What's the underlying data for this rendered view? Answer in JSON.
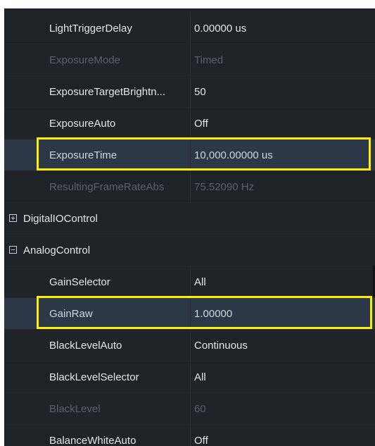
{
  "properties": [
    {
      "name": "LightTriggerDelay",
      "value": "0.00000 us",
      "state": "normal"
    },
    {
      "name": "ExposureMode",
      "value": "Timed",
      "state": "disabled"
    },
    {
      "name": "ExposureTargetBrightn...",
      "value": "50",
      "state": "normal"
    },
    {
      "name": "ExposureAuto",
      "value": "Off",
      "state": "normal"
    },
    {
      "name": "ExposureTime",
      "value": "10,000.00000 us",
      "state": "highlighted"
    },
    {
      "name": "ResultingFrameRateAbs",
      "value": "75.52090 Hz",
      "state": "disabled"
    },
    {
      "name": "DigitalIOControl",
      "category": true,
      "expander": "+",
      "expanded": false
    },
    {
      "name": "AnalogControl",
      "category": true,
      "expander": "−",
      "expanded": true
    },
    {
      "name": "GainSelector",
      "value": "All",
      "state": "normal"
    },
    {
      "name": "GainRaw",
      "value": "1.00000",
      "state": "highlighted"
    },
    {
      "name": "BlackLevelAuto",
      "value": "Continuous",
      "state": "normal"
    },
    {
      "name": "BlackLevelSelector",
      "value": "All",
      "state": "normal"
    },
    {
      "name": "BlackLevel",
      "value": "60",
      "state": "disabled"
    },
    {
      "name": "BalanceWhiteAuto",
      "value": "Off",
      "state": "normal"
    }
  ],
  "colors": {
    "background": "#1f2226",
    "selected_row": "#2c3847",
    "highlight_outline": "#ffee00",
    "text": "#e2e6ea",
    "disabled_text": "#5b6168"
  }
}
